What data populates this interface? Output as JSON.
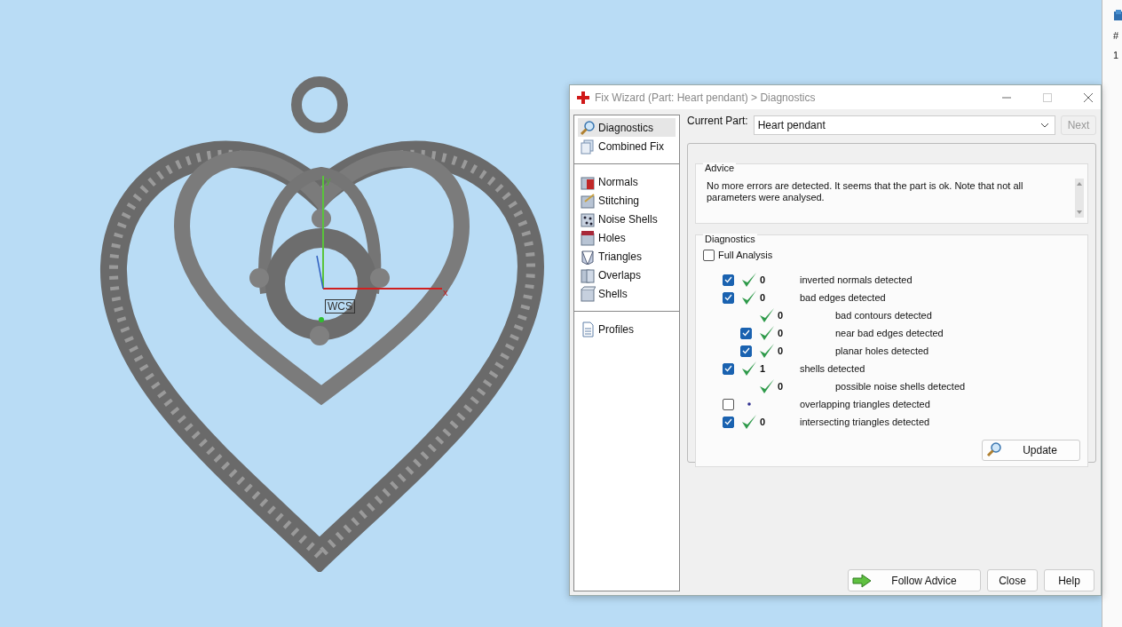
{
  "viewport": {
    "y_axis_label": "y",
    "x_axis_label": "x",
    "frame_label": "WCS"
  },
  "side_panel": {
    "header": "#",
    "cell": "1"
  },
  "window": {
    "title": "Fix Wizard (Part: Heart pendant) > Diagnostics"
  },
  "nav": {
    "groups": [
      [
        {
          "label": "Diagnostics",
          "kind": "magnifier",
          "selected": true
        },
        {
          "label": "Combined Fix",
          "kind": "cubes",
          "selected": false
        }
      ],
      [
        {
          "label": "Normals",
          "kind": "cube-red-side",
          "selected": false
        },
        {
          "label": "Stitching",
          "kind": "cube-needle",
          "selected": false
        },
        {
          "label": "Noise Shells",
          "kind": "cube-dots",
          "selected": false
        },
        {
          "label": "Holes",
          "kind": "cube-red-top",
          "selected": false
        },
        {
          "label": "Triangles",
          "kind": "cube-triangles",
          "selected": false
        },
        {
          "label": "Overlaps",
          "kind": "cube-double",
          "selected": false
        },
        {
          "label": "Shells",
          "kind": "cube",
          "selected": false
        }
      ],
      [
        {
          "label": "Profiles",
          "kind": "document",
          "selected": false
        }
      ]
    ]
  },
  "current_part": {
    "label": "Current Part:",
    "value": "Heart pendant"
  },
  "next_button": {
    "label": "Next",
    "disabled": true
  },
  "advice": {
    "title": "Advice",
    "text": "No more errors are detected. It seems that the part is ok. Note that not all parameters were analysed."
  },
  "diagnostics": {
    "title": "Diagnostics",
    "full_analysis": {
      "label": "Full Analysis",
      "checked": false
    },
    "rows": [
      {
        "kind": "checkbox",
        "checked": true,
        "passed": true,
        "count": "0",
        "label": "inverted normals detected"
      },
      {
        "kind": "checkbox",
        "checked": true,
        "passed": true,
        "count": "0",
        "label": "bad edges detected",
        "children": [
          {
            "kind": "plain",
            "passed": true,
            "count": "0",
            "label": "bad contours detected"
          },
          {
            "kind": "checkbox",
            "checked": true,
            "passed": true,
            "count": "0",
            "label": "near bad edges detected"
          },
          {
            "kind": "checkbox",
            "checked": true,
            "passed": true,
            "count": "0",
            "label": "planar holes detected"
          }
        ]
      },
      {
        "kind": "checkbox",
        "checked": true,
        "passed": true,
        "count": "1",
        "label": "shells detected",
        "children": [
          {
            "kind": "plain",
            "passed": true,
            "count": "0",
            "label": "possible noise shells detected"
          }
        ]
      },
      {
        "kind": "checkbox",
        "checked": false,
        "passed": false,
        "label": "overlapping triangles detected"
      },
      {
        "kind": "checkbox",
        "checked": true,
        "passed": true,
        "count": "0",
        "label": "intersecting triangles detected"
      }
    ],
    "update_button": "Update"
  },
  "footer_buttons": [
    {
      "kind": "follow",
      "label": "Follow Advice"
    },
    {
      "kind": "plain",
      "label": "Close"
    },
    {
      "kind": "plain",
      "label": "Help"
    }
  ]
}
